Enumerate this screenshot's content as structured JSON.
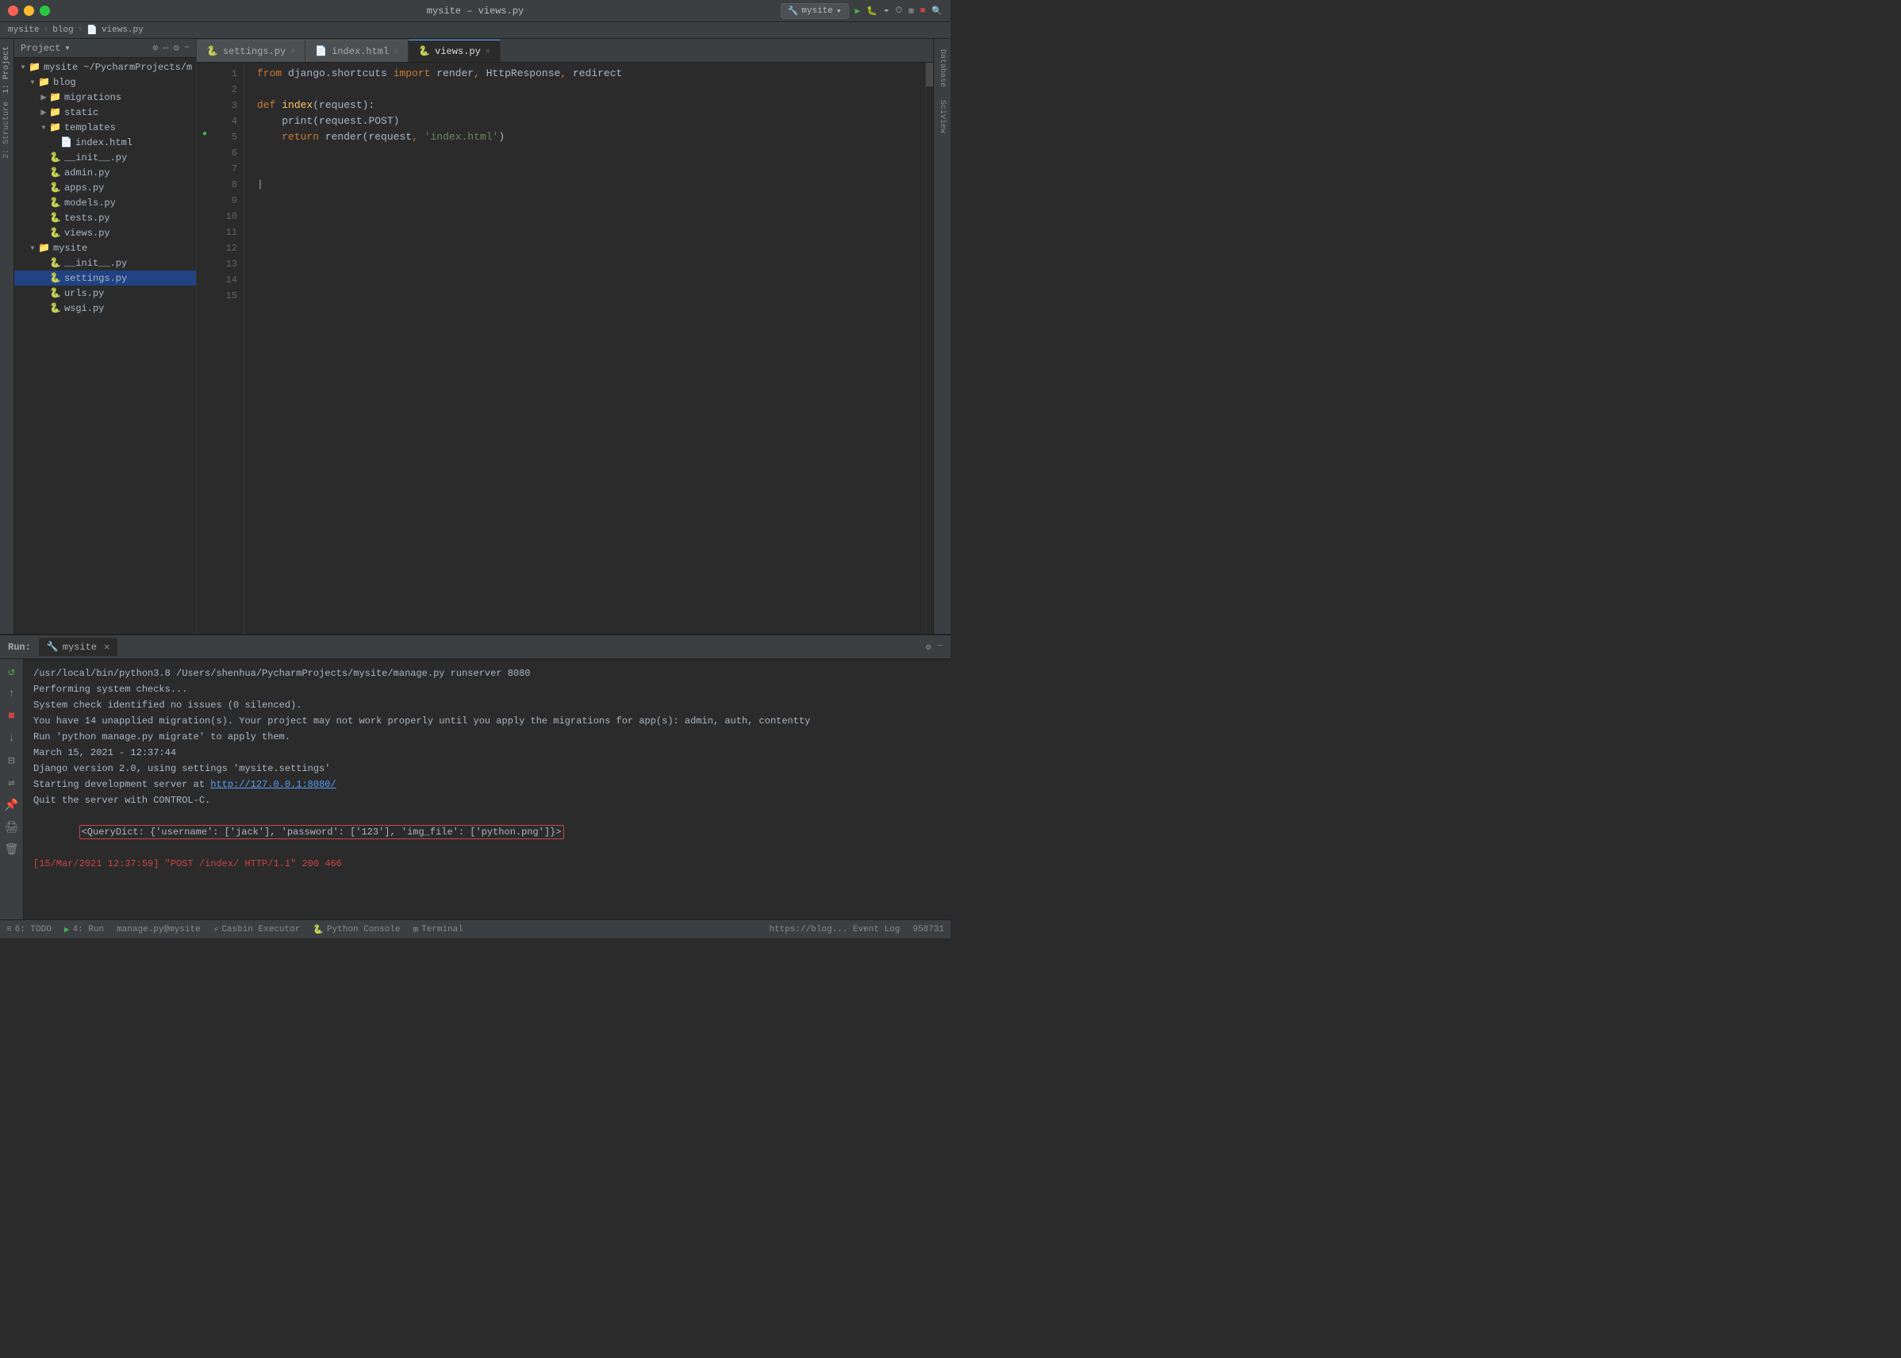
{
  "window": {
    "title": "mysite – views.py",
    "run_config": "mysite",
    "traffic_lights": [
      "close",
      "minimize",
      "maximize"
    ]
  },
  "breadcrumb": {
    "items": [
      "mysite",
      "blog",
      "views.py"
    ],
    "separators": [
      "›",
      "›"
    ]
  },
  "sidebar": {
    "panel_label": "Project",
    "side_tabs": [
      "1: Project",
      "2: Structure"
    ],
    "tree": {
      "root_label": "mysite ~/PycharmProjects/m",
      "items": [
        {
          "level": 1,
          "type": "folder",
          "label": "blog",
          "expanded": true
        },
        {
          "level": 2,
          "type": "folder",
          "label": "migrations",
          "expanded": false
        },
        {
          "level": 2,
          "type": "folder",
          "label": "static",
          "expanded": false
        },
        {
          "level": 2,
          "type": "folder",
          "label": "templates",
          "expanded": true
        },
        {
          "level": 3,
          "type": "html",
          "label": "index.html"
        },
        {
          "level": 2,
          "type": "py",
          "label": "__init__.py"
        },
        {
          "level": 2,
          "type": "py",
          "label": "admin.py"
        },
        {
          "level": 2,
          "type": "py",
          "label": "apps.py"
        },
        {
          "level": 2,
          "type": "py",
          "label": "models.py"
        },
        {
          "level": 2,
          "type": "py",
          "label": "tests.py"
        },
        {
          "level": 2,
          "type": "py",
          "label": "views.py"
        },
        {
          "level": 1,
          "type": "folder",
          "label": "mysite",
          "expanded": true
        },
        {
          "level": 2,
          "type": "py",
          "label": "__init__.py"
        },
        {
          "level": 2,
          "type": "py",
          "label": "settings.py",
          "selected": true
        },
        {
          "level": 2,
          "type": "py",
          "label": "urls.py"
        },
        {
          "level": 2,
          "type": "py",
          "label": "wsgi.py"
        }
      ]
    }
  },
  "editor": {
    "tabs": [
      {
        "label": "settings.py",
        "type": "py",
        "active": false
      },
      {
        "label": "index.html",
        "type": "html",
        "active": false
      },
      {
        "label": "views.py",
        "type": "py",
        "active": true
      }
    ],
    "code_lines": [
      {
        "num": 1,
        "content": "from django.shortcuts import render, HttpResponse, redirect"
      },
      {
        "num": 2,
        "content": ""
      },
      {
        "num": 3,
        "content": "def index(request):"
      },
      {
        "num": 4,
        "content": "    print(request.POST)"
      },
      {
        "num": 5,
        "content": "    return render(request, 'index.html')"
      },
      {
        "num": 6,
        "content": ""
      },
      {
        "num": 7,
        "content": ""
      },
      {
        "num": 8,
        "content": "",
        "cursor": true
      },
      {
        "num": 9,
        "content": ""
      },
      {
        "num": 10,
        "content": ""
      },
      {
        "num": 11,
        "content": ""
      },
      {
        "num": 12,
        "content": ""
      },
      {
        "num": 13,
        "content": ""
      },
      {
        "num": 14,
        "content": ""
      },
      {
        "num": 15,
        "content": ""
      }
    ]
  },
  "right_tabs": [
    "Database",
    "SciView"
  ],
  "bottom": {
    "run_label": "Run:",
    "run_tab_label": "mysite",
    "gear_icon": "⚙",
    "minimize_icon": "−",
    "console_lines": [
      "/usr/local/bin/python3.8 /Users/shenhua/PycharmProjects/mysite/manage.py runserver 8080",
      "Performing system checks...",
      "",
      "System check identified no issues (0 silenced).",
      "",
      "You have 14 unapplied migration(s). Your project may not work properly until you apply the migrations for app(s): admin, auth, contentty",
      "Run 'python manage.py migrate' to apply them.",
      "March 15, 2021 - 12:37:44",
      "Django version 2.0, using settings 'mysite.settings'",
      "Starting development server at http://127.0.0.1:8080/",
      "Quit the server with CONTROL-C.",
      "",
      "<QueryDict: {'username': ['jack'], 'password': ['123'], 'img_file': ['python.png']}>",
      "[15/Mar/2021 12:37:59] \"POST /index/ HTTP/1.1\" 200 466"
    ],
    "server_url": "http://127.0.0.1:8080/"
  },
  "status_bar": {
    "items_left": [
      "≡ 6: TODO",
      "▶ 4: Run",
      "manage.py@mysite",
      "⚡ Casbin Executor",
      "🐍 Python Console",
      "⊞ Terminal"
    ],
    "items_right": [
      "https://blog... Event Log",
      "958731"
    ]
  }
}
